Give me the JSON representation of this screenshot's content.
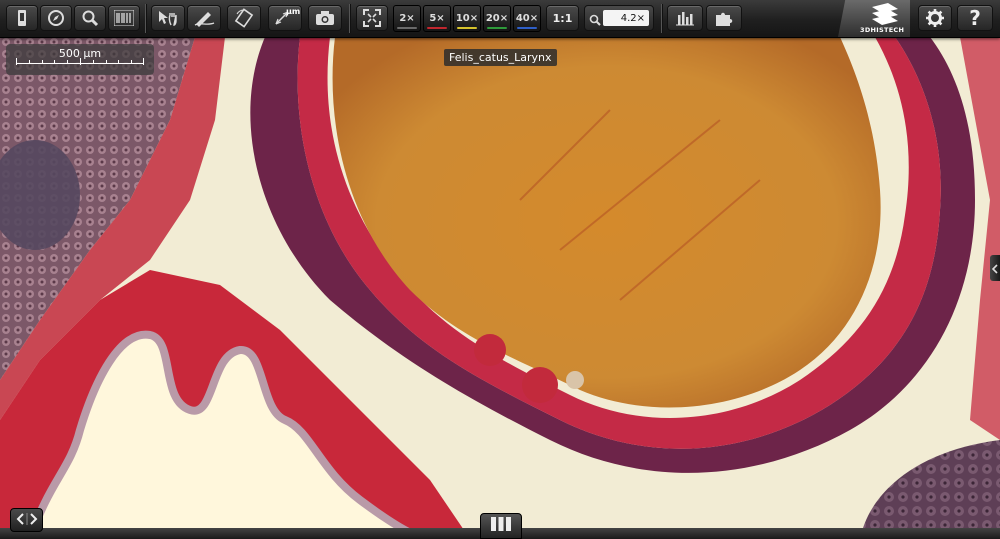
{
  "slide": {
    "name": "Felis_catus_Larynx"
  },
  "scale_bar": {
    "label": "500 µm"
  },
  "toolbar": {
    "magnifications": [
      {
        "label": "2×",
        "color": "#6a6a6a"
      },
      {
        "label": "5×",
        "color": "#c0262e"
      },
      {
        "label": "10×",
        "color": "#d6c22c"
      },
      {
        "label": "20×",
        "color": "#2e9a3a"
      },
      {
        "label": "40×",
        "color": "#2f5fc7"
      }
    ],
    "one_to_one": "1:1",
    "zoom_value": "4.2×",
    "measure_unit": "µm",
    "brand": "3DHISTECH"
  },
  "icons": {
    "slide_tray": "slide-icon",
    "navigator": "compass-icon",
    "magnifier": "magnifier-icon",
    "barcode": "barcode-icon",
    "pointer_pan": "pointer-hand-icon",
    "annotate": "pen-icon",
    "rotate": "rotate-icon",
    "measure": "ruler-icon",
    "snapshot": "camera-icon",
    "fullscreen": "fullscreen-icon",
    "histogram": "histogram-icon",
    "plugins": "puzzle-icon",
    "settings": "gear-icon",
    "help": "help-icon"
  }
}
